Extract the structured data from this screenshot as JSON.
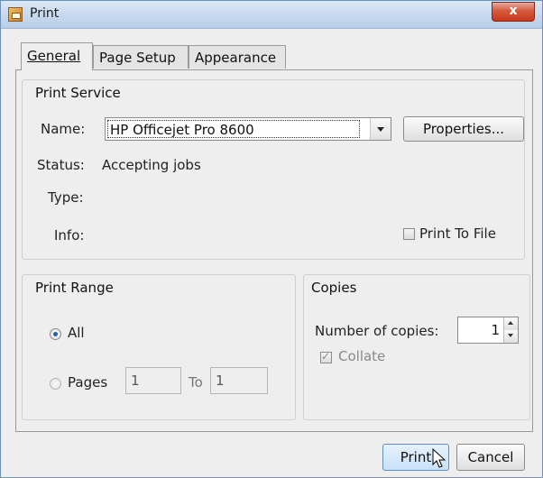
{
  "window": {
    "title": "Print",
    "close_label": "x"
  },
  "tabs": [
    {
      "label": "General",
      "active": true
    },
    {
      "label": "Page Setup",
      "active": false
    },
    {
      "label": "Appearance",
      "active": false
    }
  ],
  "print_service": {
    "title": "Print Service",
    "name_label": "Name:",
    "name_value": "HP Officejet Pro 8600",
    "properties_label": "Properties...",
    "status_label": "Status:",
    "status_value": "Accepting jobs",
    "type_label": "Type:",
    "info_label": "Info:",
    "print_to_file_label": "Print To File",
    "print_to_file_checked": false
  },
  "print_range": {
    "title": "Print Range",
    "all_label": "All",
    "all_selected": true,
    "pages_label": "Pages",
    "from_value": "1",
    "to_label": "To",
    "to_value": "1"
  },
  "copies": {
    "title": "Copies",
    "number_label": "Number of copies:",
    "number_value": "1",
    "collate_label": "Collate",
    "collate_checked": true,
    "collate_enabled": false
  },
  "buttons": {
    "print_label": "Print",
    "cancel_label": "Cancel"
  },
  "colors": {
    "title_bar": "#c6d8ee",
    "close_button": "#d6593d",
    "dialog_bg": "#eeeeee",
    "radio_dot": "#2a5fa8"
  }
}
